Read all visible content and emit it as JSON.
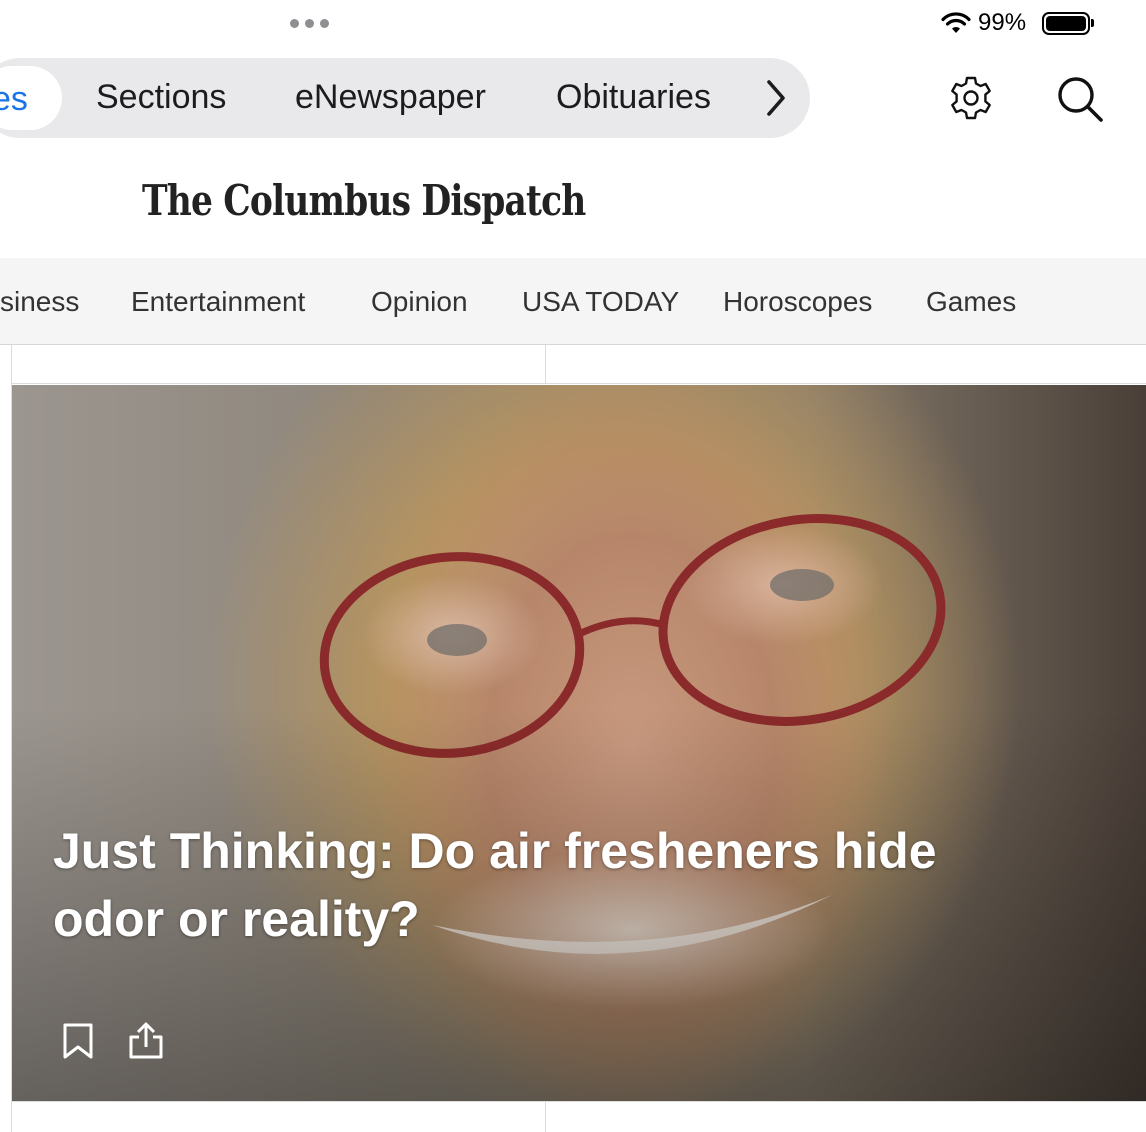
{
  "status_bar": {
    "battery_percent": "99%",
    "battery_level": 0.99
  },
  "top_nav": {
    "active_tab": "es",
    "tabs": [
      "Sections",
      "eNewspaper",
      "Obituaries"
    ]
  },
  "masthead": {
    "logo_text": "The Columbus Dispatch"
  },
  "section_nav": {
    "items": [
      "siness",
      "Entertainment",
      "Opinion",
      "USA TODAY",
      "Horoscopes",
      "Games"
    ]
  },
  "hero": {
    "headline": "Just Thinking: Do air fresheners hide odor or reality?"
  },
  "icons": [
    "multitask-dots-icon",
    "wifi-icon",
    "battery-icon",
    "chevron-right-icon",
    "gear-icon",
    "search-icon",
    "bookmark-icon",
    "share-icon"
  ],
  "colors": {
    "accent": "#1a73e8",
    "pill_background": "#e9e9ec",
    "section_nav_background": "#f5f5f5"
  }
}
